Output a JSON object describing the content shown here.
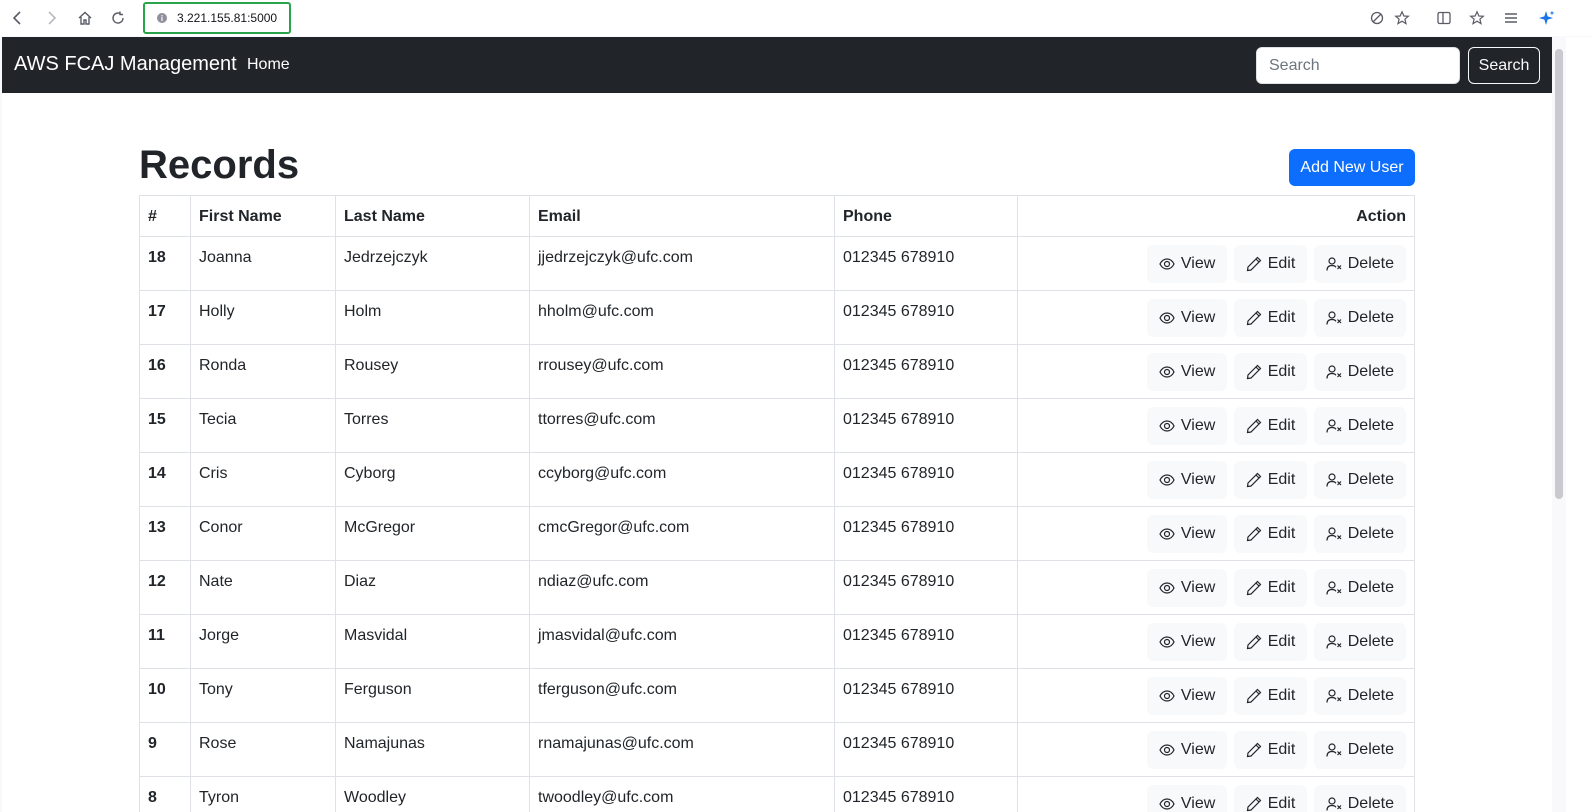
{
  "browser": {
    "url": "3.221.155.81:5000"
  },
  "navbar": {
    "brand": "AWS FCAJ Management",
    "home": "Home",
    "search_placeholder": "Search",
    "search_button": "Search"
  },
  "page": {
    "title": "Records",
    "add_button": "Add New User"
  },
  "table": {
    "headers": [
      "#",
      "First Name",
      "Last Name",
      "Email",
      "Phone",
      "Action"
    ],
    "actions": {
      "view": "View",
      "edit": "Edit",
      "delete": "Delete"
    },
    "rows": [
      {
        "id": "18",
        "first": "Joanna",
        "last": "Jedrzejczyk",
        "email": "jjedrzejczyk@ufc.com",
        "phone": "012345 678910"
      },
      {
        "id": "17",
        "first": "Holly",
        "last": "Holm",
        "email": "hholm@ufc.com",
        "phone": "012345 678910"
      },
      {
        "id": "16",
        "first": "Ronda",
        "last": "Rousey",
        "email": "rrousey@ufc.com",
        "phone": "012345 678910"
      },
      {
        "id": "15",
        "first": "Tecia",
        "last": "Torres",
        "email": "ttorres@ufc.com",
        "phone": "012345 678910"
      },
      {
        "id": "14",
        "first": "Cris",
        "last": "Cyborg",
        "email": "ccyborg@ufc.com",
        "phone": "012345 678910"
      },
      {
        "id": "13",
        "first": "Conor",
        "last": "McGregor",
        "email": "cmcGregor@ufc.com",
        "phone": "012345 678910"
      },
      {
        "id": "12",
        "first": "Nate",
        "last": "Diaz",
        "email": "ndiaz@ufc.com",
        "phone": "012345 678910"
      },
      {
        "id": "11",
        "first": "Jorge",
        "last": "Masvidal",
        "email": "jmasvidal@ufc.com",
        "phone": "012345 678910"
      },
      {
        "id": "10",
        "first": "Tony",
        "last": "Ferguson",
        "email": "tferguson@ufc.com",
        "phone": "012345 678910"
      },
      {
        "id": "9",
        "first": "Rose",
        "last": "Namajunas",
        "email": "rnamajunas@ufc.com",
        "phone": "012345 678910"
      },
      {
        "id": "8",
        "first": "Tyron",
        "last": "Woodley",
        "email": "twoodley@ufc.com",
        "phone": "012345 678910"
      }
    ]
  }
}
